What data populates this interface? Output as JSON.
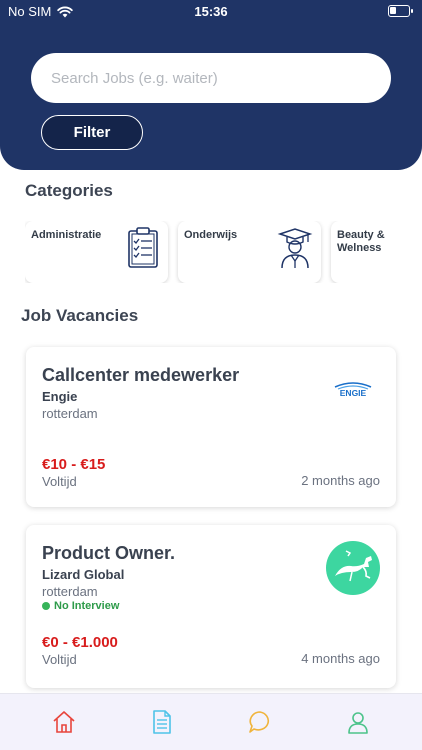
{
  "status_bar": {
    "carrier": "No SIM",
    "time": "15:36",
    "battery_level": 0.35
  },
  "search": {
    "placeholder": "Search Jobs (e.g. waiter)",
    "value": ""
  },
  "filter": {
    "label": "Filter"
  },
  "categories": {
    "title": "Categories",
    "items": [
      {
        "label": "Administratie",
        "icon": "clipboard-checklist-icon"
      },
      {
        "label": "Onderwijs",
        "icon": "graduate-icon"
      },
      {
        "label": "Beauty & Welness",
        "icon": ""
      }
    ]
  },
  "jobs": {
    "title": "Job Vacancies",
    "items": [
      {
        "title": "Callcenter medewerker",
        "company": "Engie",
        "logo_text": "ENGIE",
        "city": "rotterdam",
        "badge": "",
        "salary": "€10 - €15",
        "type": "Voltijd",
        "posted": "2 months ago"
      },
      {
        "title": "Product Owner.",
        "company": "Lizard Global",
        "logo_text": "",
        "city": "rotterdam",
        "badge": "No Interview",
        "salary": "€0 - €1.000",
        "type": "Voltijd",
        "posted": "4 months ago"
      }
    ]
  },
  "bottom_nav": [
    {
      "name": "home",
      "icon": "home-icon",
      "color": "#e8453c",
      "active": true
    },
    {
      "name": "documents",
      "icon": "document-icon",
      "color": "#4ec3e8",
      "active": false
    },
    {
      "name": "messages",
      "icon": "chat-bubble-icon",
      "color": "#f0b43c",
      "active": false
    },
    {
      "name": "profile",
      "icon": "user-icon",
      "color": "#4cc38a",
      "active": false
    }
  ],
  "colors": {
    "header": "#1f3466",
    "salary": "#d81c1c",
    "badge_green": "#2e9b4a",
    "lizard_green": "#3dd6a0",
    "engie_blue": "#1a6fc9"
  }
}
